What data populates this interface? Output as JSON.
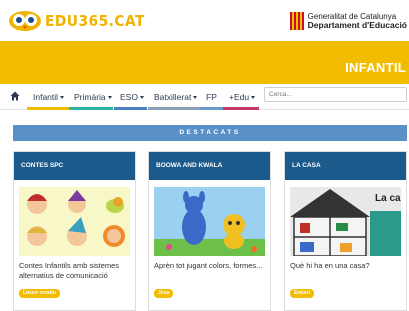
{
  "header": {
    "logo_text": "EDU365.CAT",
    "gencat_line1": "Generalitat de Catalunya",
    "gencat_line2": "Departament d'Educació"
  },
  "banner": {
    "title": "INFANTIL",
    "color": "#f2bd00"
  },
  "nav": {
    "home_icon": "home-icon",
    "items": [
      {
        "label": "Infantil",
        "has_dropdown": true,
        "color": "#f2bd00"
      },
      {
        "label": "Primària",
        "has_dropdown": true,
        "color": "#2db4a0"
      },
      {
        "label": "ESO",
        "has_dropdown": true,
        "color": "#4a7fc0"
      },
      {
        "label": "Batxillerat",
        "has_dropdown": true,
        "color": "#8aa0b4"
      },
      {
        "label": "FP",
        "has_dropdown": false,
        "color": "#6a9bc8"
      },
      {
        "label": "+Edu",
        "has_dropdown": true,
        "color": "#c43a6a"
      }
    ],
    "search_placeholder": "Cerca..."
  },
  "destacats": {
    "label": "DESTACATS"
  },
  "cards": [
    {
      "title": "CONTES SPC",
      "description": "Contes Infantils amb sistemes alternatius de comunicació",
      "badge": "Lleure creatiu"
    },
    {
      "title": "BOOWA AND KWALA",
      "description": "Aprèn tot jugant colors, formes...",
      "badge": "Joca"
    },
    {
      "title": "LA CASA",
      "description": "Què hi ha en una casa?",
      "badge": "Entorn",
      "image_text": "La casa"
    }
  ]
}
